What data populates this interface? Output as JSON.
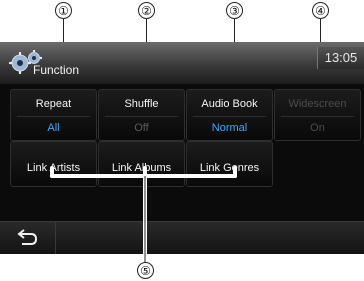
{
  "callouts": [
    "①",
    "②",
    "③",
    "④",
    "⑤"
  ],
  "header": {
    "title": "Function",
    "time": "13:05",
    "icon": "gear-icon"
  },
  "settings": [
    {
      "label": "Repeat",
      "value": "All",
      "enabled": true
    },
    {
      "label": "Shuffle",
      "value": "Off",
      "enabled": true
    },
    {
      "label": "Audio Book",
      "value": "Normal",
      "enabled": true
    },
    {
      "label": "Widescreen",
      "value": "On",
      "enabled": false
    }
  ],
  "links": [
    {
      "label": "Link Artists"
    },
    {
      "label": "Link Albums"
    },
    {
      "label": "Link Genres"
    }
  ],
  "footer": {
    "back_icon": "back-arrow-icon"
  },
  "colors": {
    "value_active": "#3ea8ff",
    "disabled_text": "#4b4b4b",
    "background": "#0b0b0b",
    "callout_line": "#222222"
  }
}
